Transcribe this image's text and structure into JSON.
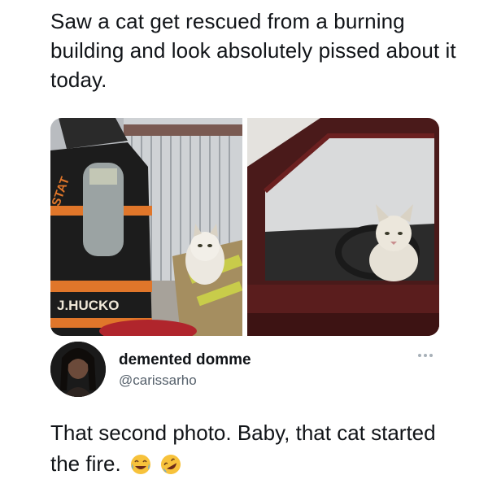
{
  "caption": {
    "text": "Saw a cat get rescued from a burning building and look absolutely pissed about it today."
  },
  "photos": {
    "left": {
      "helmet_text": "STAT",
      "jacket_text": "J.HUCKO",
      "colors": {
        "jacket": "#1c1c1c",
        "reflective": "#c8cc4a",
        "stripe": "#e0762a"
      }
    },
    "right": {
      "colors": {
        "car": "#5a1d1d",
        "cat": "#d9d2c4"
      }
    }
  },
  "tweet": {
    "display_name": "demented domme",
    "handle": "@carissarho",
    "text": "That second photo. Baby, that cat started the fire.",
    "emojis": [
      "face-with-tears-of-joy-icon",
      "rolling-on-floor-laughing-icon"
    ]
  }
}
